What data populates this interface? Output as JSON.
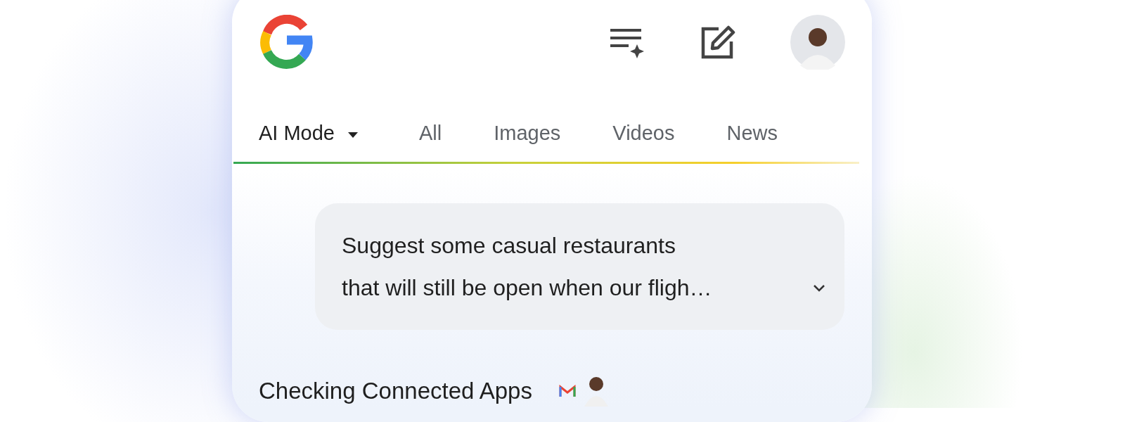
{
  "tabs": [
    {
      "label": "AI Mode",
      "selected": true,
      "kind": "dropdown"
    },
    {
      "label": "All",
      "selected": false,
      "kind": "plain"
    },
    {
      "label": "Images",
      "selected": false,
      "kind": "plain"
    },
    {
      "label": "Videos",
      "selected": false,
      "kind": "plain"
    },
    {
      "label": "News",
      "selected": false,
      "kind": "plain"
    }
  ],
  "prompt": {
    "lines": [
      "Suggest some casual restaurants",
      "that will still be open when our fligh…"
    ],
    "expanded": false
  },
  "status": {
    "label": "Checking Connected Apps"
  }
}
